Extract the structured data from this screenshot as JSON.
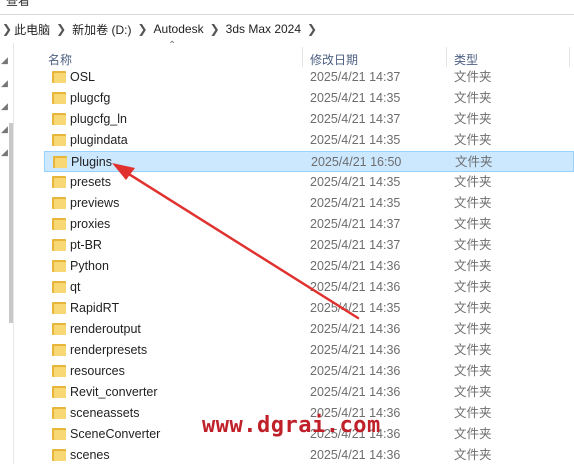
{
  "menu": {
    "left_label": "查看"
  },
  "address": {
    "crumbs": [
      "此电脑",
      "新加卷 (D:)",
      "Autodesk",
      "3ds Max 2024"
    ]
  },
  "columns": {
    "name": "名称",
    "date": "修改日期",
    "type": "类型"
  },
  "rows": [
    {
      "name": "OSL",
      "date": "2025/4/21 14:37",
      "type": "文件夹"
    },
    {
      "name": "plugcfg",
      "date": "2025/4/21 14:35",
      "type": "文件夹"
    },
    {
      "name": "plugcfg_ln",
      "date": "2025/4/21 14:37",
      "type": "文件夹"
    },
    {
      "name": "plugindata",
      "date": "2025/4/21 14:35",
      "type": "文件夹"
    },
    {
      "name": "Plugins",
      "date": "2025/4/21 16:50",
      "type": "文件夹",
      "selected": true
    },
    {
      "name": "presets",
      "date": "2025/4/21 14:35",
      "type": "文件夹"
    },
    {
      "name": "previews",
      "date": "2025/4/21 14:35",
      "type": "文件夹"
    },
    {
      "name": "proxies",
      "date": "2025/4/21 14:37",
      "type": "文件夹"
    },
    {
      "name": "pt-BR",
      "date": "2025/4/21 14:37",
      "type": "文件夹"
    },
    {
      "name": "Python",
      "date": "2025/4/21 14:36",
      "type": "文件夹"
    },
    {
      "name": "qt",
      "date": "2025/4/21 14:36",
      "type": "文件夹"
    },
    {
      "name": "RapidRT",
      "date": "2025/4/21 14:35",
      "type": "文件夹"
    },
    {
      "name": "renderoutput",
      "date": "2025/4/21 14:36",
      "type": "文件夹"
    },
    {
      "name": "renderpresets",
      "date": "2025/4/21 14:36",
      "type": "文件夹"
    },
    {
      "name": "resources",
      "date": "2025/4/21 14:36",
      "type": "文件夹"
    },
    {
      "name": "Revit_converter",
      "date": "2025/4/21 14:36",
      "type": "文件夹"
    },
    {
      "name": "sceneassets",
      "date": "2025/4/21 14:36",
      "type": "文件夹"
    },
    {
      "name": "SceneConverter",
      "date": "2025/4/21 14:36",
      "type": "文件夹"
    },
    {
      "name": "scenes",
      "date": "2025/4/21 14:36",
      "type": "文件夹"
    }
  ],
  "watermark": "www.dgrai.com",
  "colors": {
    "selection": "#cce8ff",
    "arrow": "#e0312f",
    "folder": "#f8d775"
  }
}
